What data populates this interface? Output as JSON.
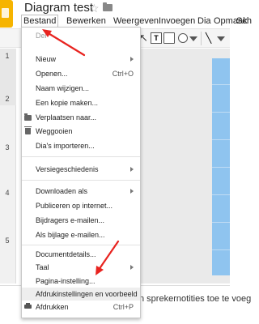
{
  "app": {
    "doc_title": "Diagram test",
    "star_icon": "star-icon",
    "folder_icon": "folder-icon"
  },
  "menubar": {
    "items": [
      "Bestand",
      "Bewerken",
      "Weergeven",
      "Invoegen",
      "Dia",
      "Opmaak",
      "Sch"
    ]
  },
  "slides": {
    "numbers": [
      "1",
      "2",
      "3",
      "4",
      "5"
    ]
  },
  "notes": {
    "placeholder": "n sprekernotities toe te voeg"
  },
  "file_menu": {
    "top_partial": "Del",
    "items": [
      {
        "label": "Nieuw",
        "submenu": true
      },
      {
        "label": "Openen...",
        "shortcut": "Ctrl+O"
      },
      {
        "label": "Naam wijzigen..."
      },
      {
        "label": "Een kopie maken..."
      },
      {
        "label": "Verplaatsen naar...",
        "icon": "folder-icon"
      },
      {
        "label": "Weggooien",
        "icon": "trash-icon"
      },
      {
        "label": "Dia's importeren..."
      },
      {
        "label": "Versiegeschiedenis",
        "submenu": true
      },
      {
        "label": "Downloaden als",
        "submenu": true
      },
      {
        "label": "Publiceren op internet..."
      },
      {
        "label": "Bijdragers e-mailen..."
      },
      {
        "label": "Als bijlage e-mailen..."
      },
      {
        "label": "Documentdetails..."
      },
      {
        "label": "Taal",
        "submenu": true
      },
      {
        "label": "Pagina-instelling..."
      },
      {
        "label": "Afdrukinstellingen en voorbeeld"
      },
      {
        "label": "Afdrukken",
        "shortcut": "Ctrl+P",
        "icon": "print-icon"
      }
    ]
  },
  "colors": {
    "logo": "#f6b400",
    "annotation_arrow": "#e8231f",
    "diagram_fill": "#8fc4ef"
  }
}
